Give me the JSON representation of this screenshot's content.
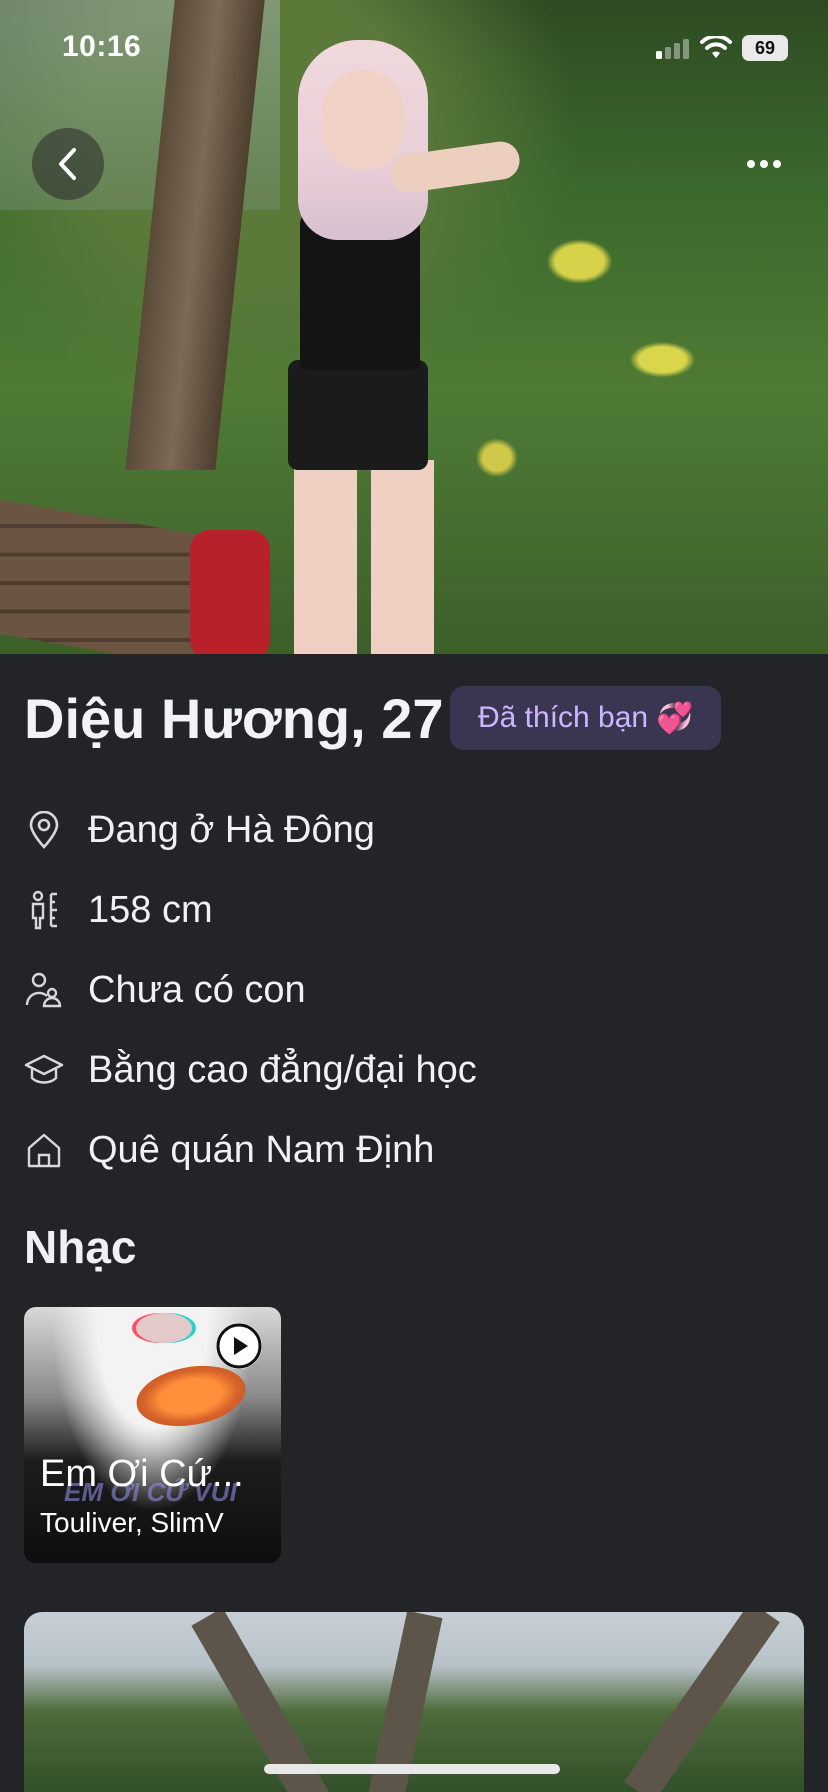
{
  "status_bar": {
    "time": "10:16",
    "battery": "69"
  },
  "hero": {
    "photo_alt": "profile-photo"
  },
  "profile": {
    "name_age": "Diệu Hương, 27",
    "liked_badge": "Đã thích bạn",
    "liked_emoji": "💞",
    "details": [
      {
        "icon": "location-icon",
        "text": "Đang ở Hà Đông"
      },
      {
        "icon": "height-icon",
        "text": "158 cm"
      },
      {
        "icon": "children-icon",
        "text": "Chưa có con"
      },
      {
        "icon": "education-icon",
        "text": "Bằng cao đẳng/đại học"
      },
      {
        "icon": "hometown-icon",
        "text": "Quê quán Nam Định"
      }
    ]
  },
  "music": {
    "section_title": "Nhạc",
    "song": {
      "title": "Em Ơi Cứ...",
      "artist": "Touliver, SlimV",
      "cover_text": "EM ƠI CỨ VUI"
    }
  },
  "colors": {
    "background": "#232427",
    "badge_bg": "#3a3550",
    "badge_text": "#c9b7ff"
  }
}
